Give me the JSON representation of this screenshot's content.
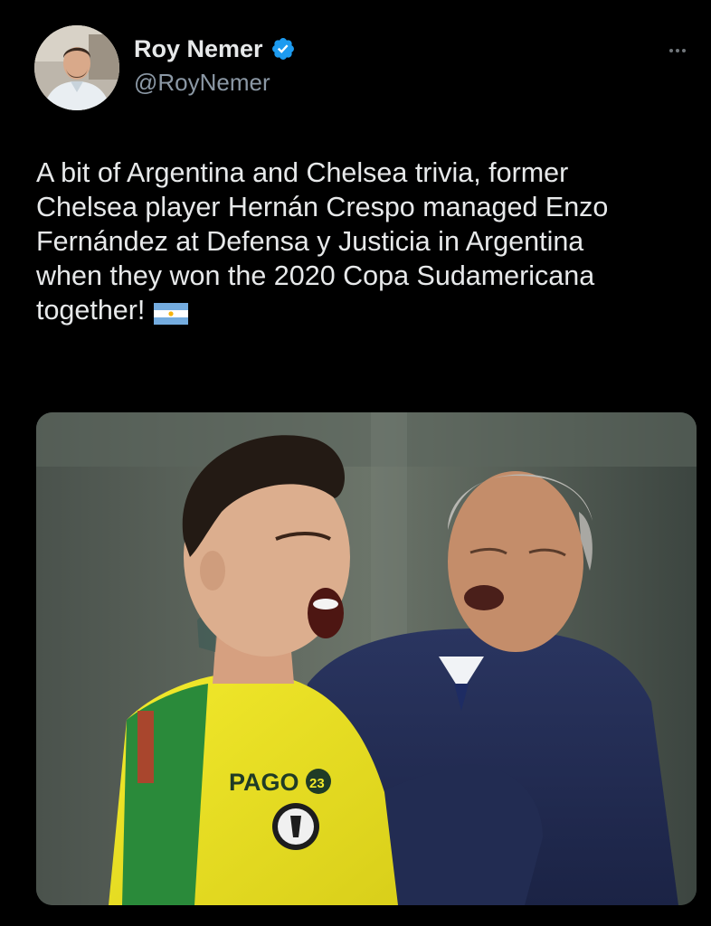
{
  "author": {
    "display_name": "Roy Nemer",
    "handle": "@RoyNemer",
    "verified": true,
    "verified_icon": "verified-badge-icon",
    "verified_color": "#1d9bf0"
  },
  "menu": {
    "icon": "more-horizontal-icon"
  },
  "tweet": {
    "text": "A bit of Argentina and Chelsea trivia, former\nChelsea player Hernán Crespo managed Enzo\nFernández at Defensa y Justicia in Argentina\nwhen they won the 2020 Copa Sudamericana\ntogether!",
    "emoji": "argentina-flag-icon"
  },
  "media": {
    "kit_sponsor": "PAGO",
    "kit_number": "23"
  },
  "colors": {
    "background": "#000000",
    "text_primary": "#e7e9ea",
    "text_secondary": "#8b98a5",
    "accent": "#1d9bf0"
  }
}
